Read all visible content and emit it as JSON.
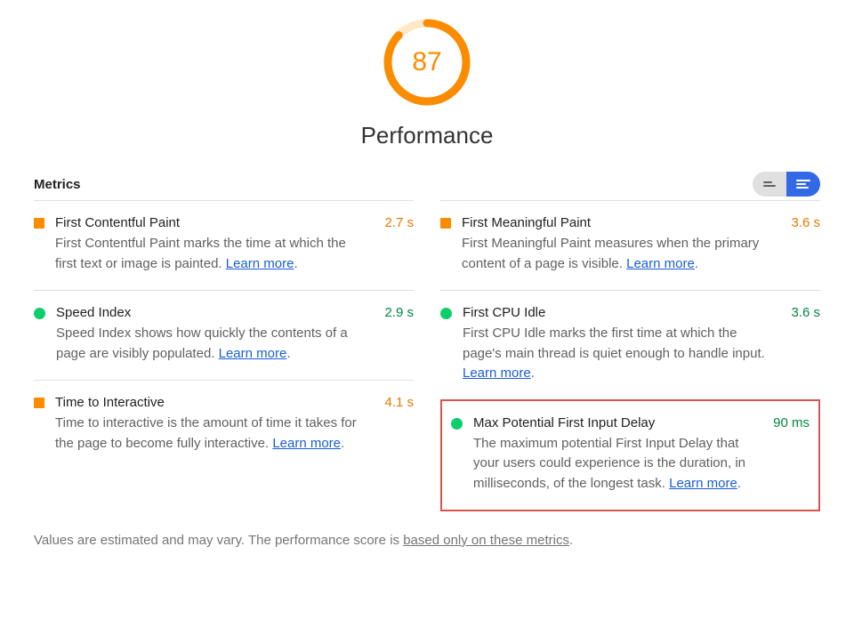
{
  "score": "87",
  "score_pct": 87,
  "title": "Performance",
  "metrics_label": "Metrics",
  "learn_more": "Learn more",
  "columns": [
    [
      {
        "marker": "square",
        "name": "First Contentful Paint",
        "desc": "First Contentful Paint marks the time at which the first text or image is painted. ",
        "value": "2.7 s",
        "value_class": "orange",
        "highlighted": false
      },
      {
        "marker": "circle",
        "name": "Speed Index",
        "desc": "Speed Index shows how quickly the contents of a page are visibly populated. ",
        "value": "2.9 s",
        "value_class": "green",
        "highlighted": false
      },
      {
        "marker": "square",
        "name": "Time to Interactive",
        "desc": "Time to interactive is the amount of time it takes for the page to become fully interactive. ",
        "value": "4.1 s",
        "value_class": "orange",
        "highlighted": false
      }
    ],
    [
      {
        "marker": "square",
        "name": "First Meaningful Paint",
        "desc": "First Meaningful Paint measures when the primary content of a page is visible. ",
        "value": "3.6 s",
        "value_class": "orange",
        "highlighted": false
      },
      {
        "marker": "circle",
        "name": "First CPU Idle",
        "desc": "First CPU Idle marks the first time at which the page's main thread is quiet enough to handle input. ",
        "value": "3.6 s",
        "value_class": "green",
        "highlighted": false
      },
      {
        "marker": "circle",
        "name": "Max Potential First Input Delay",
        "desc": "The maximum potential First Input Delay that your users could experience is the duration, in milliseconds, of the longest task. ",
        "value": "90 ms",
        "value_class": "green",
        "highlighted": true
      }
    ]
  ],
  "footnote_prefix": "Values are estimated and may vary. The performance score is ",
  "footnote_link": "based only on these metrics",
  "footnote_suffix": "."
}
